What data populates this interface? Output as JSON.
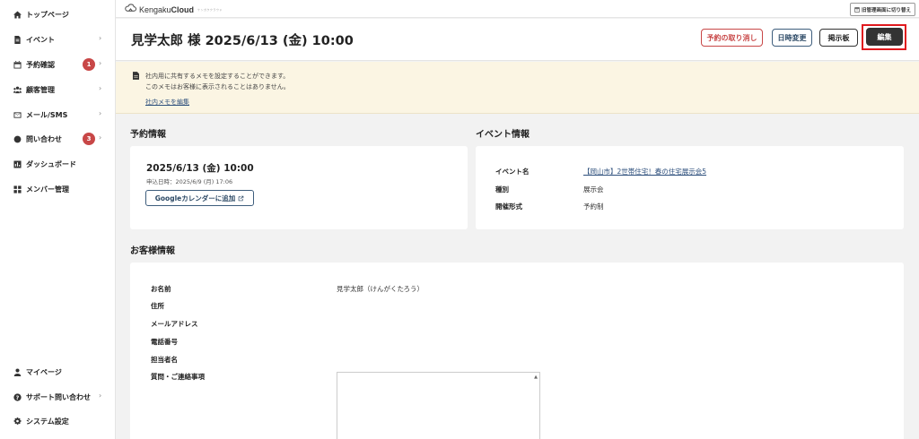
{
  "sidebar": {
    "items": [
      {
        "label": "トップページ",
        "icon": "home-icon"
      },
      {
        "label": "イベント",
        "icon": "document-icon",
        "chevron": "›"
      },
      {
        "label": "予約確認",
        "icon": "calendar-icon",
        "badge": "1",
        "chevron": "›"
      },
      {
        "label": "顧客管理",
        "icon": "users-icon",
        "chevron": "›"
      },
      {
        "label": "メール/SMS",
        "icon": "mail-icon",
        "chevron": "›"
      },
      {
        "label": "問い合わせ",
        "icon": "chat-icon",
        "badge": "3",
        "chevron": "›"
      },
      {
        "label": "ダッシュボード",
        "icon": "chart-icon"
      },
      {
        "label": "メンバー管理",
        "icon": "grid-icon"
      }
    ],
    "bottom_items": [
      {
        "label": "マイページ",
        "icon": "person-icon"
      },
      {
        "label": "サポート問い合わせ",
        "icon": "help-icon",
        "chevron": "›"
      },
      {
        "label": "システム設定",
        "icon": "gear-icon"
      }
    ]
  },
  "topbar": {
    "logo_text_regular": "Kengaku",
    "logo_text_bold": "Cloud",
    "logo_sub": "ケンガククラウド",
    "switch_label": "旧管理画面に切り替え"
  },
  "header": {
    "title": "見学太郎 様 2025/6/13 (金) 10:00",
    "cancel_label": "予約の取り消し",
    "reschedule_label": "日時変更",
    "board_label": "掲示板",
    "edit_label": "編集"
  },
  "memo": {
    "line1": "社内用に共有するメモを設定することができます。",
    "line2": "このメモはお客様に表示されることはありません。",
    "link": "社内メモを編集"
  },
  "reservation": {
    "section_title": "予約情報",
    "date": "2025/6/13 (金) 10:00",
    "applied": "申込日時：2025/6/9 (月) 17:06",
    "gcal_label": "Googleカレンダーに追加"
  },
  "event": {
    "section_title": "イベント情報",
    "rows": [
      {
        "label": "イベント名",
        "value": "【岡山市】2世帯住宅！春の住宅展示会5"
      },
      {
        "label": "種別",
        "value": "展示会"
      },
      {
        "label": "開催形式",
        "value": "予約制"
      }
    ]
  },
  "customer": {
    "section_title": "お客様情報",
    "rows": [
      {
        "label": "お名前",
        "value": "見学太郎（けんがくたろう）"
      },
      {
        "label": "住所",
        "value": ""
      },
      {
        "label": "メールアドレス",
        "value": ""
      },
      {
        "label": "電話番号",
        "value": ""
      },
      {
        "label": "担当者名",
        "value": ""
      },
      {
        "label": "質問・ご連絡事項",
        "value": ""
      }
    ]
  },
  "colors": {
    "accent_red": "#c84747",
    "highlight_red": "#e0191e",
    "link_blue": "#2d4f7c",
    "memo_bg": "#fbf5e3",
    "edit_bg": "#333333"
  }
}
